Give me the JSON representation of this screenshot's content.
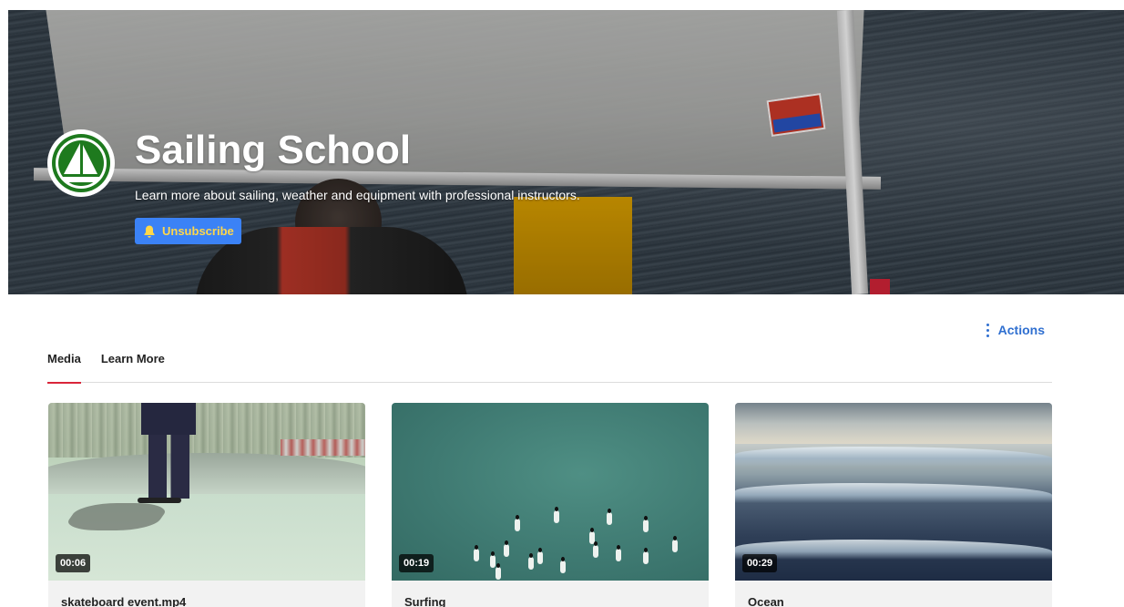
{
  "hero": {
    "title": "Sailing School",
    "description": "Learn more about sailing, weather and equipment with professional instructors.",
    "unsubscribe_label": "Unsubscribe",
    "bell_icon": "bell-icon",
    "avatar_icon": "sailboat-logo-icon",
    "brand_color": "#1e7a1e",
    "button_color": "#3b82f6",
    "button_text_color": "#ffd74a"
  },
  "actions": {
    "label": "Actions",
    "icon": "kebab-menu-icon",
    "color": "#2f6fd0"
  },
  "tabs": [
    {
      "label": "Media",
      "active": true
    },
    {
      "label": "Learn More",
      "active": false
    }
  ],
  "tab_accent_color": "#d9253a",
  "media": [
    {
      "title": "skateboard event.mp4",
      "duration": "00:06"
    },
    {
      "title": "Surfing",
      "duration": "00:19"
    },
    {
      "title": "Ocean",
      "duration": "00:29"
    }
  ]
}
